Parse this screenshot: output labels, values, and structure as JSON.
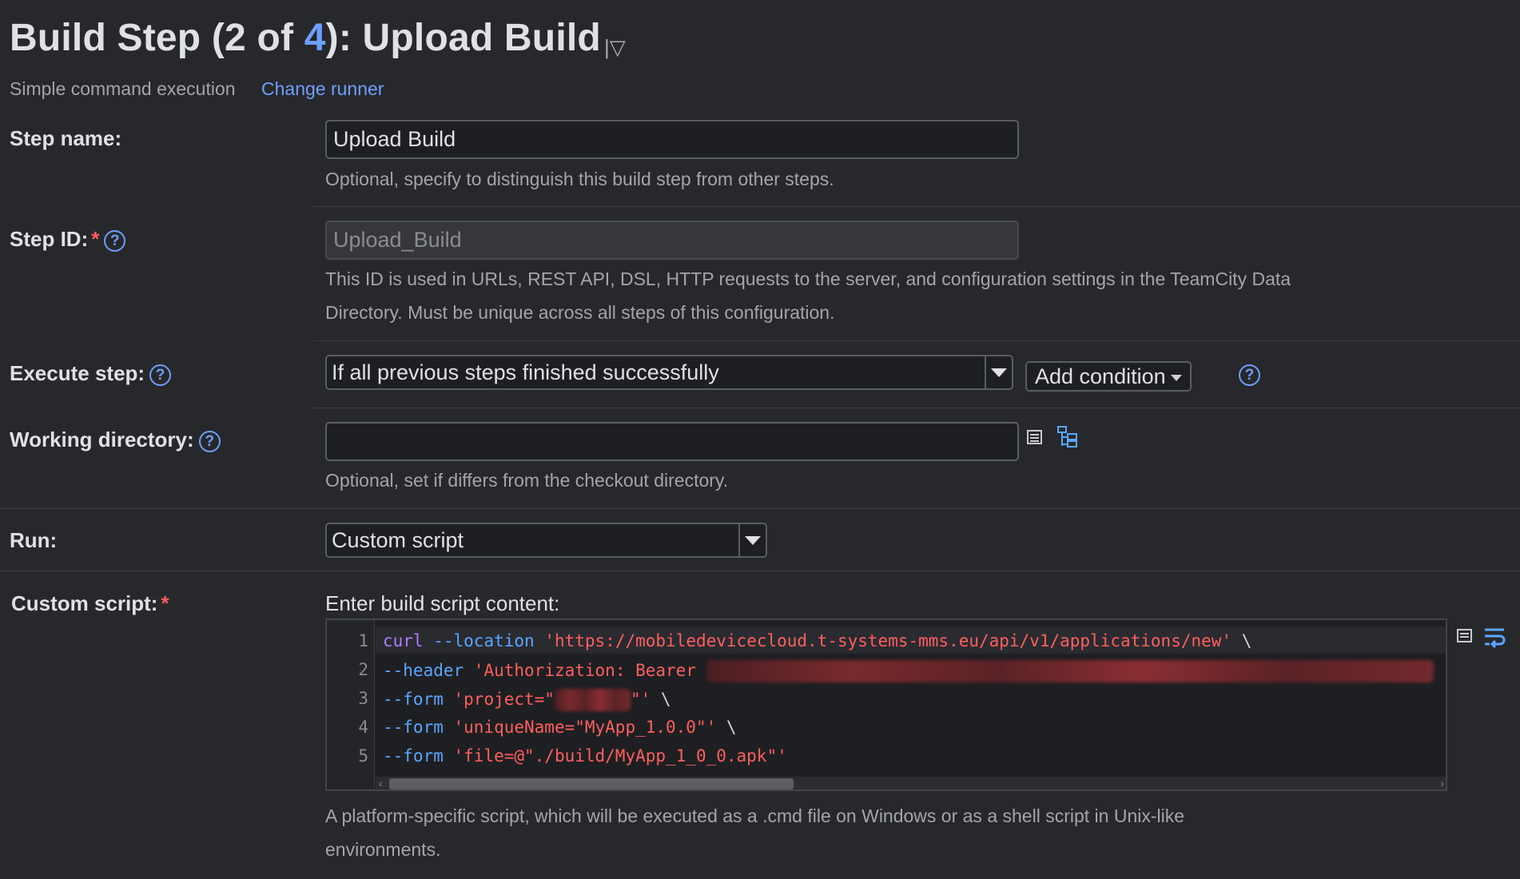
{
  "header": {
    "title_prefix": "Build Step (2 of ",
    "title_total": "4",
    "title_suffix": "): Upload Build",
    "runner_type": "Simple command execution",
    "change_runner_label": "Change runner"
  },
  "step_name": {
    "label": "Step name:",
    "value": "Upload Build",
    "hint": "Optional, specify to distinguish this build step from other steps."
  },
  "step_id": {
    "label": "Step ID:",
    "required_mark": "*",
    "value": "Upload_Build",
    "hint_line1": "This ID is used in URLs, REST API, DSL, HTTP requests to the server, and configuration settings in the TeamCity Data",
    "hint_line2": "Directory. Must be unique across all steps of this configuration."
  },
  "execute_step": {
    "label": "Execute step:",
    "selected": "If all previous steps finished successfully",
    "add_condition_label": "Add condition"
  },
  "working_directory": {
    "label": "Working directory:",
    "value": "",
    "hint": "Optional, set if differs from the checkout directory."
  },
  "run": {
    "label": "Run:",
    "selected": "Custom script"
  },
  "custom_script": {
    "label": "Custom script:",
    "required_mark": "*",
    "prompt": "Enter build script content:",
    "lines": [
      {
        "n": "1",
        "cmd": "curl",
        "opt": "--location",
        "str": "'https://mobiledevicecloud.t-systems-mms.eu/api/v1/applications/new'",
        "tail": " \\"
      },
      {
        "n": "2",
        "opt": "--header",
        "str": "'Authorization: Bearer "
      },
      {
        "n": "3",
        "opt": "--form",
        "str_a": "'project=\"",
        "str_b": "\"'",
        "tail": " \\"
      },
      {
        "n": "4",
        "opt": "--form",
        "str": "'uniqueName=\"MyApp_1.0.0\"'",
        "tail": " \\"
      },
      {
        "n": "5",
        "opt": "--form",
        "str": "'file=@\"./build/MyApp_1_0_0.apk\"'"
      }
    ],
    "hint_line1": "A platform-specific script, which will be executed as a .cmd file on Windows or as a shell script in Unix-like",
    "hint_line2": "environments."
  },
  "help_symbol": "?"
}
